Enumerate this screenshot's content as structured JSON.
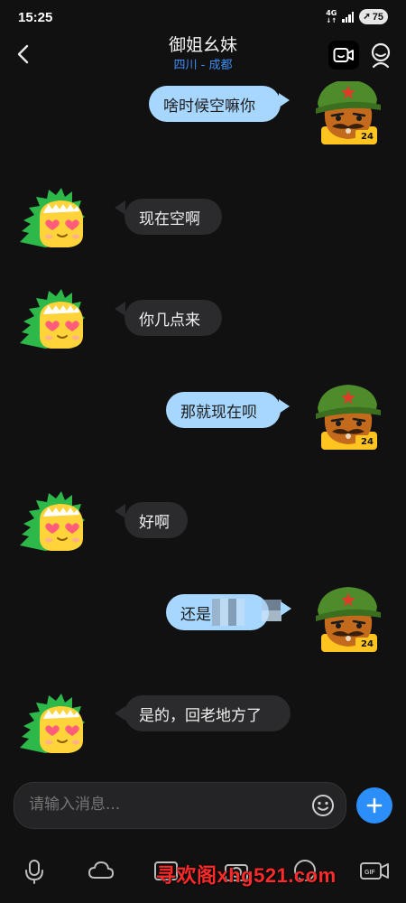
{
  "status_bar": {
    "time": "15:25",
    "network": "4G",
    "battery": "75"
  },
  "header": {
    "title": "御姐幺妹",
    "location": "四川 - 成都"
  },
  "messages": [
    {
      "direction": "out",
      "text": "啥时候空嘛你",
      "avatar": "soldier-avatar"
    },
    {
      "direction": "in",
      "text": "现在空啊",
      "avatar": "dino-avatar"
    },
    {
      "direction": "in",
      "text": "你几点来",
      "avatar": "dino-avatar"
    },
    {
      "direction": "out",
      "text": "那就现在呗",
      "avatar": "soldier-avatar"
    },
    {
      "direction": "in",
      "text": "好啊",
      "avatar": "dino-avatar"
    },
    {
      "direction": "out",
      "text": "还是",
      "avatar": "soldier-avatar"
    },
    {
      "direction": "in",
      "text": "是的，回老地方了",
      "avatar": "dino-avatar"
    }
  ],
  "avatar_badge": "24",
  "composer": {
    "placeholder": "请输入消息..."
  },
  "toolbar": {
    "items": [
      "mic-icon",
      "cloud-icon",
      "photo-icon",
      "camera-icon",
      "emoji-icon",
      "gif-icon"
    ],
    "gif_label": "GIF"
  },
  "watermark": "寻欢阁xhg521.com",
  "colors": {
    "background": "#111111",
    "incoming_bubble": "#2b2b2d",
    "outgoing_bubble": "#a7d7ff",
    "accent": "#2c8ef8",
    "location": "#3e8ef7"
  }
}
